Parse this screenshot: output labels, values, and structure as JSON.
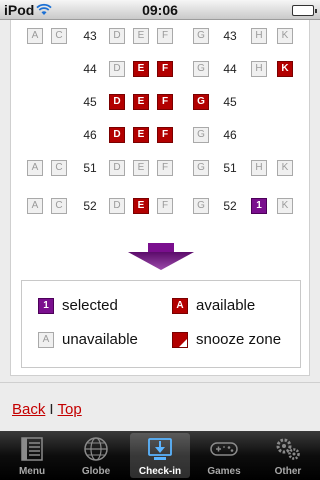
{
  "status_bar": {
    "carrier": "iPod",
    "time": "09:06",
    "icons": [
      "wifi-icon",
      "battery-icon"
    ]
  },
  "seat_map": {
    "rows": [
      {
        "labels": [
          "43",
          "43"
        ],
        "seats": [
          {
            "letter": "A",
            "state": "unavailable"
          },
          {
            "letter": "C",
            "state": "unavailable"
          },
          {
            "letter": "D",
            "state": "unavailable"
          },
          {
            "letter": "E",
            "state": "unavailable"
          },
          {
            "letter": "F",
            "state": "unavailable"
          },
          {
            "letter": "G",
            "state": "unavailable"
          },
          {
            "letter": "H",
            "state": "unavailable"
          },
          {
            "letter": "K",
            "state": "unavailable"
          }
        ]
      },
      {
        "labels": [
          "44",
          "44"
        ],
        "seats": [
          {
            "letter": "D",
            "state": "unavailable"
          },
          {
            "letter": "E",
            "state": "available"
          },
          {
            "letter": "F",
            "state": "available"
          },
          {
            "letter": "G",
            "state": "unavailable"
          },
          {
            "letter": "H",
            "state": "unavailable"
          },
          {
            "letter": "K",
            "state": "available"
          }
        ]
      },
      {
        "labels": [
          "45",
          "45"
        ],
        "seats": [
          {
            "letter": "D",
            "state": "available"
          },
          {
            "letter": "E",
            "state": "available"
          },
          {
            "letter": "F",
            "state": "available"
          },
          {
            "letter": "G",
            "state": "available"
          }
        ]
      },
      {
        "labels": [
          "46",
          "46"
        ],
        "seats": [
          {
            "letter": "D",
            "state": "available"
          },
          {
            "letter": "E",
            "state": "available"
          },
          {
            "letter": "F",
            "state": "available"
          },
          {
            "letter": "G",
            "state": "unavailable"
          }
        ]
      },
      {
        "labels": [
          "51",
          "51"
        ],
        "seats": [
          {
            "letter": "A",
            "state": "unavailable"
          },
          {
            "letter": "C",
            "state": "unavailable"
          },
          {
            "letter": "D",
            "state": "unavailable"
          },
          {
            "letter": "E",
            "state": "unavailable"
          },
          {
            "letter": "F",
            "state": "unavailable"
          },
          {
            "letter": "G",
            "state": "unavailable"
          },
          {
            "letter": "H",
            "state": "unavailable"
          },
          {
            "letter": "K",
            "state": "unavailable"
          }
        ]
      },
      {
        "labels": [
          "52",
          "52"
        ],
        "seats": [
          {
            "letter": "A",
            "state": "unavailable"
          },
          {
            "letter": "C",
            "state": "unavailable"
          },
          {
            "letter": "D",
            "state": "unavailable"
          },
          {
            "letter": "E",
            "state": "available"
          },
          {
            "letter": "F",
            "state": "unavailable"
          },
          {
            "letter": "G",
            "state": "unavailable"
          },
          {
            "letter": "1",
            "state": "selected"
          },
          {
            "letter": "K",
            "state": "unavailable"
          }
        ]
      }
    ]
  },
  "legend": {
    "selected": {
      "swatch": "1",
      "label": "selected"
    },
    "available": {
      "swatch": "A",
      "label": "available"
    },
    "unavailable": {
      "swatch": "A",
      "label": "unavailable"
    },
    "snooze": {
      "label": "snooze zone"
    }
  },
  "links": {
    "back": "Back",
    "separator": "I",
    "top": "Top"
  },
  "tab_bar": {
    "tabs": [
      {
        "label": "Menu",
        "icon": "menu-icon"
      },
      {
        "label": "Globe",
        "icon": "globe-icon"
      },
      {
        "label": "Check-in",
        "icon": "check-in-icon",
        "active": true
      },
      {
        "label": "Games",
        "icon": "gamepad-icon"
      },
      {
        "label": "Other",
        "icon": "gears-icon"
      }
    ]
  },
  "colors": {
    "available": "#b20000",
    "selected": "#7a0f8e",
    "unavailable_border": "#a9a9a9",
    "link": "#c40000",
    "arrow": "#7a0f8e"
  }
}
